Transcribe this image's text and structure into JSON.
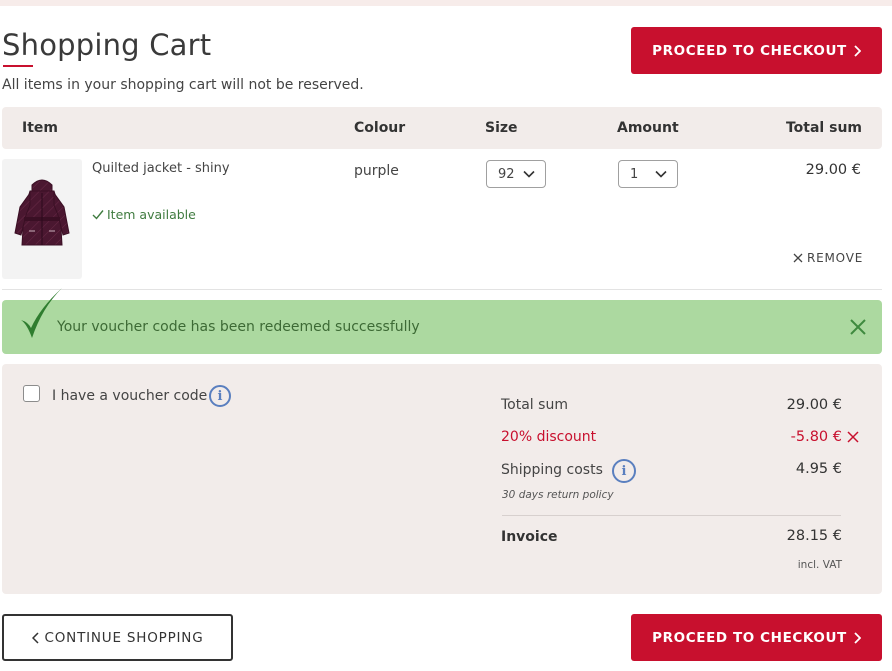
{
  "page": {
    "title": "Shopping Cart",
    "subtitle": "All items in your shopping cart will not be reserved.",
    "checkout_label": "PROCEED TO CHECKOUT",
    "continue_label": "CONTINUE SHOPPING"
  },
  "table": {
    "headers": {
      "item": "Item",
      "colour": "Colour",
      "size": "Size",
      "amount": "Amount",
      "total": "Total sum"
    }
  },
  "item": {
    "name": "Quilted jacket - shiny",
    "availability": "Item available",
    "colour": "purple",
    "size": "92",
    "amount": "1",
    "price": "29.00 €",
    "remove_label": "REMOVE"
  },
  "alert": {
    "message": "Your voucher code has been redeemed successfully"
  },
  "summary": {
    "voucher_label": "I have a voucher code",
    "total_label": "Total sum",
    "total_value": "29.00 €",
    "discount_label": "20% discount",
    "discount_value": "-5.80 €",
    "shipping_label": "Shipping costs",
    "shipping_value": "4.95 €",
    "return_policy": "30 days return policy",
    "invoice_label": "Invoice",
    "invoice_value": "28.15 €",
    "vat_note": "incl. VAT"
  },
  "colors": {
    "accent": "#c8102e",
    "success_bg": "#acd9a0",
    "panel_bg": "#f2ecea",
    "info": "#5a7fbf"
  },
  "icons": {
    "checkout_chevron": "chevron-right-icon",
    "continue_chevron": "chevron-left-icon",
    "select_chevron": "chevron-down-icon",
    "remove": "close-icon",
    "availability": "check-icon",
    "alert_check": "check-icon",
    "alert_close": "close-icon",
    "info": "info-icon"
  }
}
